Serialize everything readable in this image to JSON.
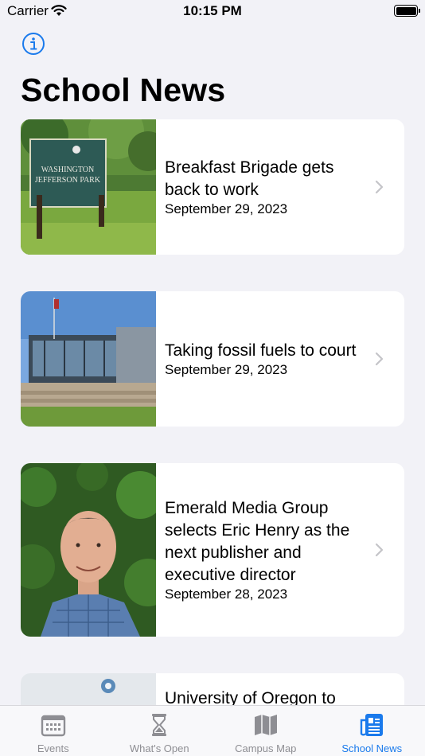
{
  "status_bar": {
    "carrier": "Carrier",
    "time": "10:15 PM",
    "icons": [
      "wifi-icon",
      "battery-icon"
    ]
  },
  "header": {
    "info_icon": "info-circle-icon",
    "title": "School News"
  },
  "articles": [
    {
      "title": "Breakfast Brigade gets back to work",
      "date": "September 29, 2023",
      "image": "Sign reading Washington Jefferson Park on a lawn",
      "sign_text_1": "WASHINGTON",
      "sign_text_2": "JEFFERSON PARK"
    },
    {
      "title": "Taking fossil fuels to court",
      "date": "September 29, 2023",
      "image": "Modern glass building with flagpole"
    },
    {
      "title": "Emerald Media Group selects Eric Henry as the next publisher and executive director",
      "date": "September 28, 2023",
      "image": "Portrait of a smiling man in plaid shirt"
    },
    {
      "title": "University of Oregon to",
      "date": "",
      "image": "Partially visible image"
    }
  ],
  "tab_bar": {
    "tabs": [
      {
        "label": "Events",
        "icon": "calendar-icon",
        "active": false
      },
      {
        "label": "What's Open",
        "icon": "hourglass-icon",
        "active": false
      },
      {
        "label": "Campus Map",
        "icon": "map-icon",
        "active": false
      },
      {
        "label": "School News",
        "icon": "newspaper-icon",
        "active": true
      }
    ]
  },
  "colors": {
    "accent": "#1a7aec",
    "background": "#f2f2f7",
    "inactive_tab": "#8e8e93"
  }
}
